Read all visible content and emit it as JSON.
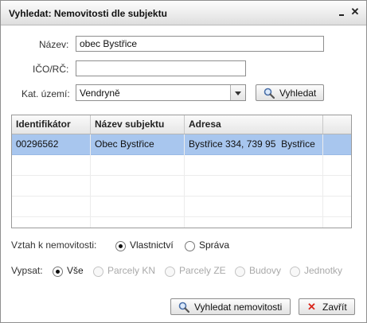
{
  "window": {
    "title": "Vyhledat: Nemovitosti dle subjektu"
  },
  "form": {
    "name_label": "Název:",
    "name_value": "obec Bystřice",
    "ico_label": "IČO/RČ:",
    "ico_value": "",
    "kat_label": "Kat. území:",
    "kat_value": "Vendryně",
    "search_button": "Vyhledat"
  },
  "grid": {
    "columns": [
      "Identifikátor",
      "Název subjektu",
      "Adresa"
    ],
    "rows": [
      {
        "id": "00296562",
        "name": "Obec Bystřice",
        "address": "Bystřice 334, 739 95  Bystřice",
        "selected": true
      }
    ]
  },
  "relation": {
    "label": "Vztah k nemovitosti:",
    "options": [
      "Vlastnictví",
      "Správa"
    ],
    "selected": "Vlastnictví"
  },
  "list": {
    "label": "Vypsat:",
    "options": [
      "Vše",
      "Parcely KN",
      "Parcely ZE",
      "Budovy",
      "Jednotky"
    ],
    "selected": "Vše"
  },
  "footer": {
    "search_button": "Vyhledat nemovitosti",
    "close_button": "Zavřít"
  },
  "colors": {
    "selection": "#a8c6ee",
    "close_x": "#d9261c"
  }
}
